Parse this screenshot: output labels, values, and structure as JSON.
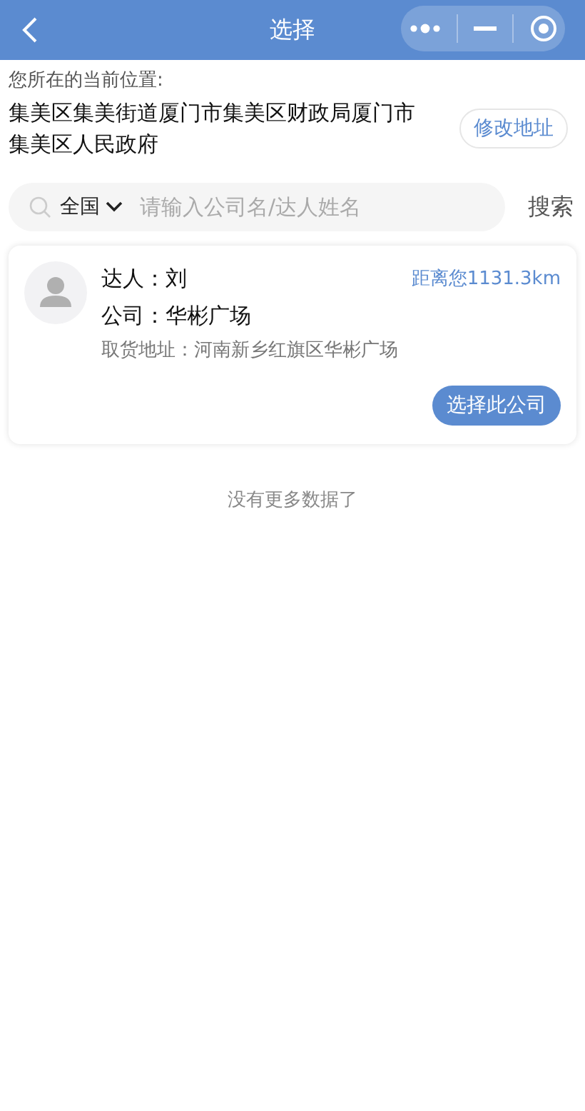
{
  "header": {
    "title": "选择"
  },
  "location": {
    "label": "您所在的当前位置:",
    "address": "集美区集美街道厦门市集美区财政局厦门市集美区人民政府",
    "change_button": "修改地址"
  },
  "search": {
    "region": "全国",
    "placeholder": "请输入公司名/达人姓名",
    "button": "搜索"
  },
  "results": [
    {
      "person": "达人：刘",
      "company": "公司：华彬广场",
      "distance": "距离您1131.3km",
      "pickup_address": "取货地址：河南新乡红旗区华彬广场",
      "select_button": "选择此公司"
    }
  ],
  "end_note": "没有更多数据了"
}
